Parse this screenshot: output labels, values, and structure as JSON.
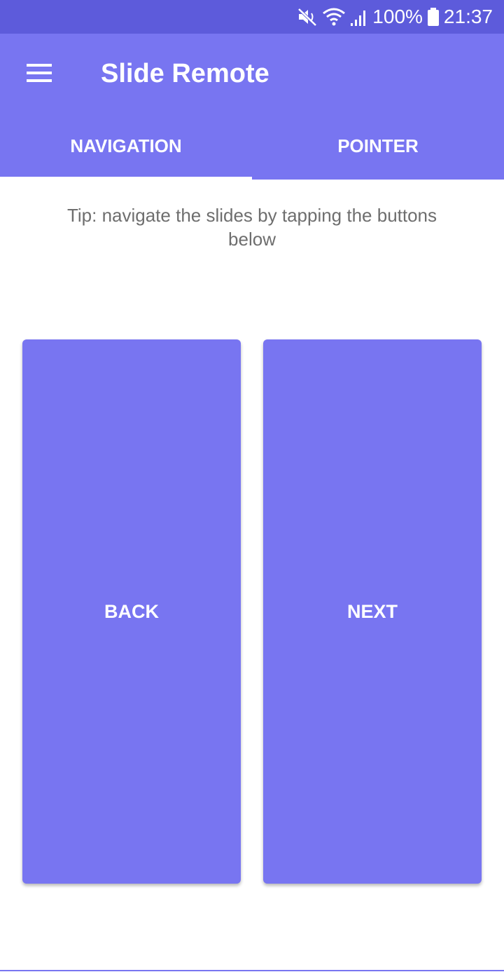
{
  "status_bar": {
    "battery_text": "100%",
    "time": "21:37",
    "icons": [
      "mute-icon",
      "wifi-icon",
      "signal-icon",
      "battery-icon"
    ]
  },
  "app_bar": {
    "title": "Slide Remote",
    "menu_icon": "hamburger-menu-icon"
  },
  "tabs": [
    {
      "label": "NAVIGATION",
      "selected": true
    },
    {
      "label": "POINTER",
      "selected": false
    }
  ],
  "tip": "Tip: navigate the slides by tapping the buttons below",
  "buttons": {
    "back_label": "BACK",
    "next_label": "NEXT"
  },
  "colors": {
    "status_bar": "#5d5bdb",
    "primary": "#7875f1",
    "tip_text": "#6e6e6e"
  }
}
